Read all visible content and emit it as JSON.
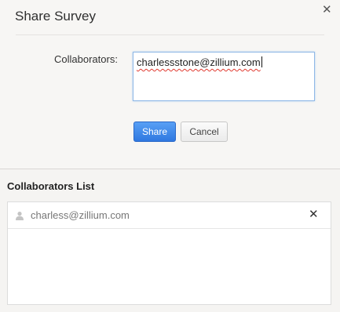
{
  "dialog": {
    "title": "Share Survey",
    "close_icon": "close-icon"
  },
  "form": {
    "collaborators_label": "Collaborators:",
    "collaborators_value": "charlessstone@zillium.com",
    "share_label": "Share",
    "cancel_label": "Cancel"
  },
  "list": {
    "heading": "Collaborators List",
    "items": [
      {
        "email": "charless@zillium.com",
        "icon": "user-icon",
        "remove_icon": "close-icon"
      }
    ]
  },
  "colors": {
    "primary_button": "#3d86ea",
    "input_focus_border": "#8fb8e6"
  }
}
